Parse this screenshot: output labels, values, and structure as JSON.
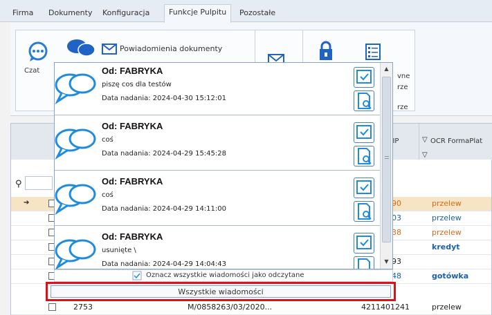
{
  "menu": {
    "items": [
      "Firma",
      "Dokumenty",
      "Konfiguracja",
      "Funkcje Pulpitu",
      "Pozostałe"
    ],
    "active_index": 3
  },
  "ribbon": {
    "chat_label": "Czat",
    "notifications_label": "Powiadomienia dokumenty",
    "partial_label_1": "vne",
    "partial_label_2": "rze",
    "partial_label_3": "rze"
  },
  "grid": {
    "col_nip": "NIP",
    "col_ocr": "OCR FormaPlat",
    "rows": [
      {
        "nip_tail": "90",
        "payment": "przelew",
        "color": "orange"
      },
      {
        "nip_tail": "03",
        "payment": "przelew",
        "color": "blue"
      },
      {
        "nip_tail": "38",
        "payment": "przelew",
        "color": "orange"
      },
      {
        "nip_tail": "",
        "payment": "kredyt",
        "color": "blue"
      },
      {
        "nip_tail": "93",
        "payment": "",
        "color": "blue"
      },
      {
        "nip_tail": "48",
        "payment": "gotówka",
        "color": "blue"
      },
      {
        "id": "2753",
        "doc": "M/0858263/03/2020...",
        "nip": "4211401241",
        "payment": "przelew",
        "color": "dark"
      }
    ]
  },
  "popup": {
    "messages": [
      {
        "from": "Od: FABRYKA",
        "body": "piszę cos dla testów",
        "date": "Data nadania: 2024-04-30 15:12:01"
      },
      {
        "from": "Od: FABRYKA",
        "body": "coś",
        "date": "Data nadania: 2024-04-29 15:45:28"
      },
      {
        "from": "Od: FABRYKA",
        "body": "coś",
        "date": "Data nadania: 2024-04-29 14:11:00"
      },
      {
        "from": "Od: FABRYKA",
        "body": "usunięte \\",
        "date": "Data nadania: 2024-04-29 14:04:43"
      }
    ],
    "mark_all_label": "Oznacz wszystkie wiadomości jako odczytane",
    "all_messages_label": "Wszystkie wiadomości"
  },
  "colors": {
    "accent": "#1a5fb4",
    "orange": "#d46a1c",
    "highlight": "#e0101a",
    "selected_row": "#f7e4c4"
  }
}
